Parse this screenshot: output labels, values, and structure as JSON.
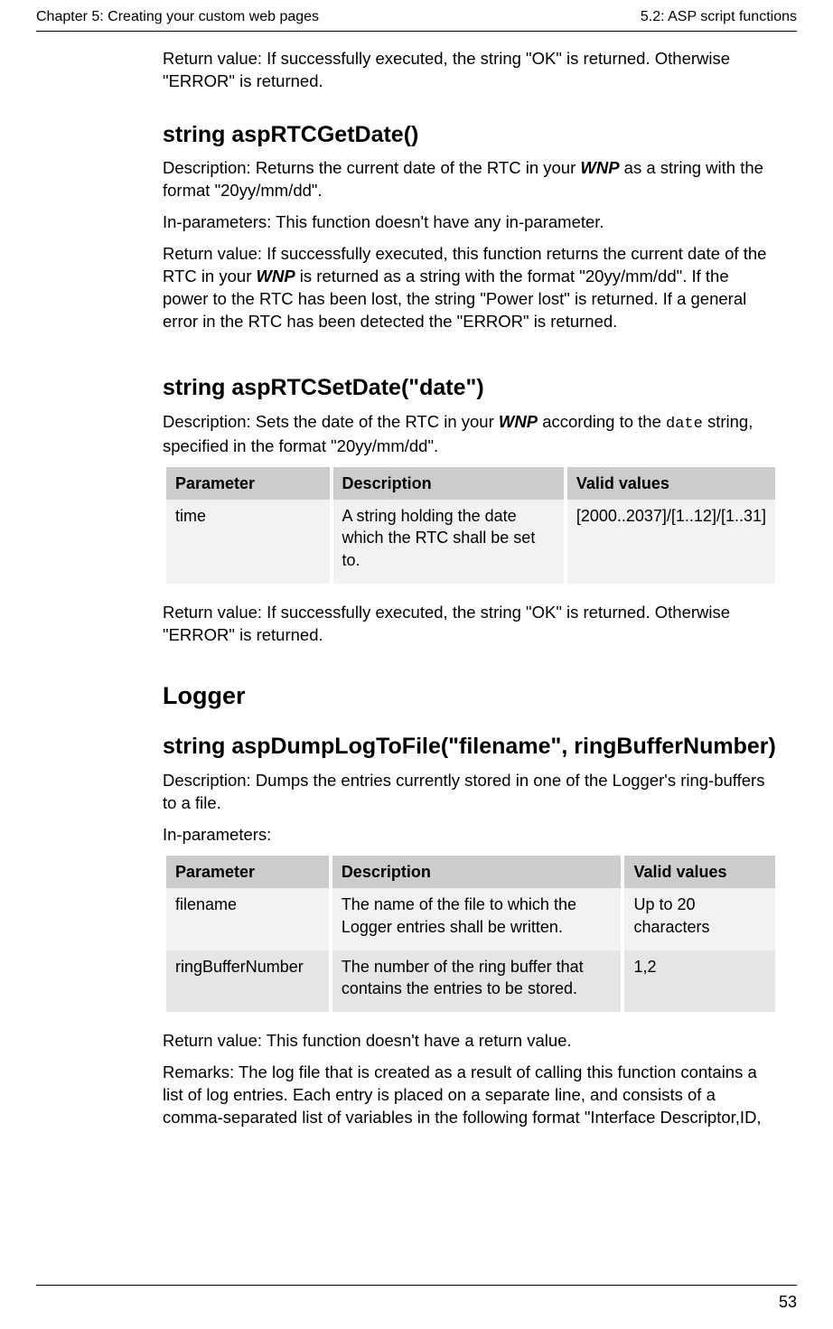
{
  "header": {
    "left": "Chapter 5: Creating your custom web pages",
    "right": "5.2: ASP script functions"
  },
  "intro_return": "Return value: If successfully executed, the string \"OK\" is returned. Otherwise \"ERROR\" is returned.",
  "s1": {
    "heading": "string aspRTCGetDate()",
    "desc_pre": "Description: Returns the current date of the RTC in your ",
    "wnp": "WNP",
    "desc_post": " as a string with the format \"20yy/mm/dd\".",
    "inparams": "In-parameters: This function doesn't have any in-parameter.",
    "ret_pre": "Return value: If successfully executed, this function returns the current date of the RTC in your ",
    "ret_post": " is returned as a string with the format \"20yy/mm/dd\". If the power to the RTC has been lost, the string \"Power lost\" is returned. If a general error in the RTC has been detected the \"ERROR\" is returned."
  },
  "s2": {
    "heading": "string aspRTCSetDate(\"date\")",
    "desc_pre": "Description: Sets the date of the RTC in your ",
    "wnp": "WNP",
    "desc_mid": " according to the ",
    "code": "date",
    "desc_post": " string, specified in the format \"20yy/mm/dd\".",
    "table": {
      "h1": "Parameter",
      "h2": "Description",
      "h3": "Valid values",
      "r1c1": "time",
      "r1c2": "A string holding the date which the RTC shall be set to.",
      "r1c3": "[2000..2037]/[1..12]/[1..31]"
    },
    "ret": "Return value: If successfully executed, the string \"OK\" is returned. Otherwise \"ERROR\" is returned."
  },
  "s3": {
    "heading_main": "Logger",
    "heading": "string aspDumpLogToFile(\"filename\", ringBufferNumber)",
    "desc": "Description: Dumps the entries currently stored in one of the Logger's ring-buffers to a file.",
    "inparams": "In-parameters:",
    "table": {
      "h1": "Parameter",
      "h2": "Description",
      "h3": "Valid values",
      "r1c1": "filename",
      "r1c2": "The name of the file to which the Logger entries shall be written.",
      "r1c3": "Up to 20 characters",
      "r2c1": "ringBufferNumber",
      "r2c2": "The number of the ring buffer that contains the entries to be stored.",
      "r2c3": "1,2"
    },
    "ret": "Return value: This function doesn't have a return value.",
    "remarks": "Remarks: The log file that is created as a result of calling this function contains a list of log entries. Each entry is placed on a separate line, and consists of a comma-separated list of variables in the following format \"Interface Descriptor,ID,"
  },
  "footer": {
    "page": "53"
  }
}
